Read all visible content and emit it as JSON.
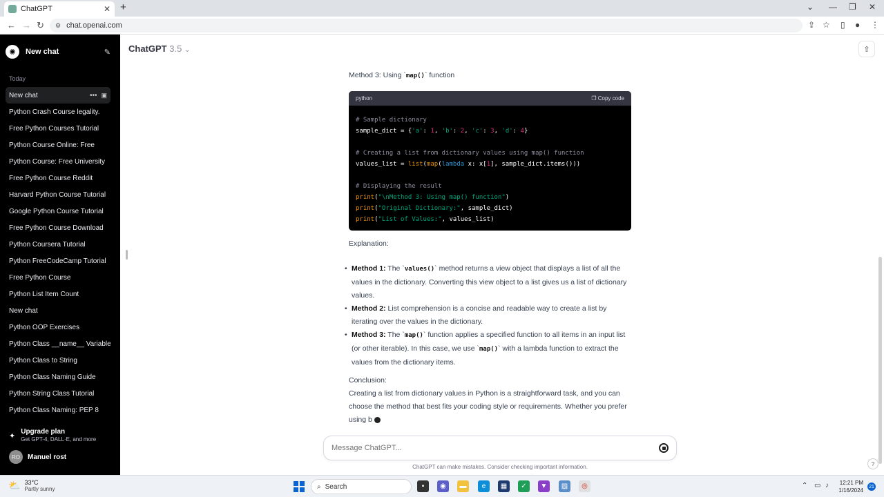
{
  "browser": {
    "tab_title": "ChatGPT",
    "url": "chat.openai.com"
  },
  "sidebar": {
    "new_chat_label": "New chat",
    "section_today": "Today",
    "chats": [
      "New chat",
      "Python Crash Course legality.",
      "Free Python Courses Tutorial",
      "Python Course Online: Free",
      "Python Course: Free University",
      "Free Python Course Reddit",
      "Harvard Python Course Tutorial",
      "Google Python Course Tutorial",
      "Free Python Course Download",
      "Python Coursera Tutorial",
      "Python FreeCodeCamp Tutorial",
      "Free Python Course",
      "Python List Item Count",
      "New chat",
      "Python OOP Exercises",
      "Python Class __name__ Variable",
      "Python Class to String",
      "Python Class Naming Guide",
      "Python String Class Tutorial",
      "Python Class Naming: PEP 8"
    ],
    "upgrade_title": "Upgrade plan",
    "upgrade_sub": "Get GPT-4, DALL·E, and more",
    "user_initials": "RO",
    "user_name": "Manuel rost"
  },
  "header": {
    "model_name": "ChatGPT",
    "model_version": "3.5"
  },
  "message": {
    "method3_prefix": "Method 3: Using `",
    "method3_code": "map()",
    "method3_suffix": "` function",
    "code_lang": "python",
    "copy_label": "Copy code",
    "explanation_label": "Explanation:",
    "b1_title": "Method 1:",
    "b1_pre": " The `",
    "b1_code": "values()",
    "b1_post": "` method returns a view object that displays a list of all the values in the dictionary. Converting this view object to a list gives us a list of dictionary values.",
    "b2_title": "Method 2:",
    "b2_text": " List comprehension is a concise and readable way to create a list by iterating over the values in the dictionary.",
    "b3_title": "Method 3:",
    "b3_pre": " The `",
    "b3_code1": "map()",
    "b3_mid": "` function applies a specified function to all items in an input list (or other iterable). In this case, we use `",
    "b3_code2": "map()",
    "b3_post": "` with a lambda function to extract the values from the dictionary items.",
    "conclusion_label": "Conclusion:",
    "conclusion_text": "Creating a list from dictionary values in Python is a straightforward task, and you can choose the method that best fits your coding style or requirements. Whether you prefer using b"
  },
  "composer": {
    "placeholder": "Message ChatGPT...",
    "disclaimer": "ChatGPT can make mistakes. Consider checking important information."
  },
  "taskbar": {
    "temp": "33°C",
    "weather": "Partly sunny",
    "search_label": "Search",
    "time": "12:21 PM",
    "date": "1/16/2024",
    "notif_count": "21"
  }
}
